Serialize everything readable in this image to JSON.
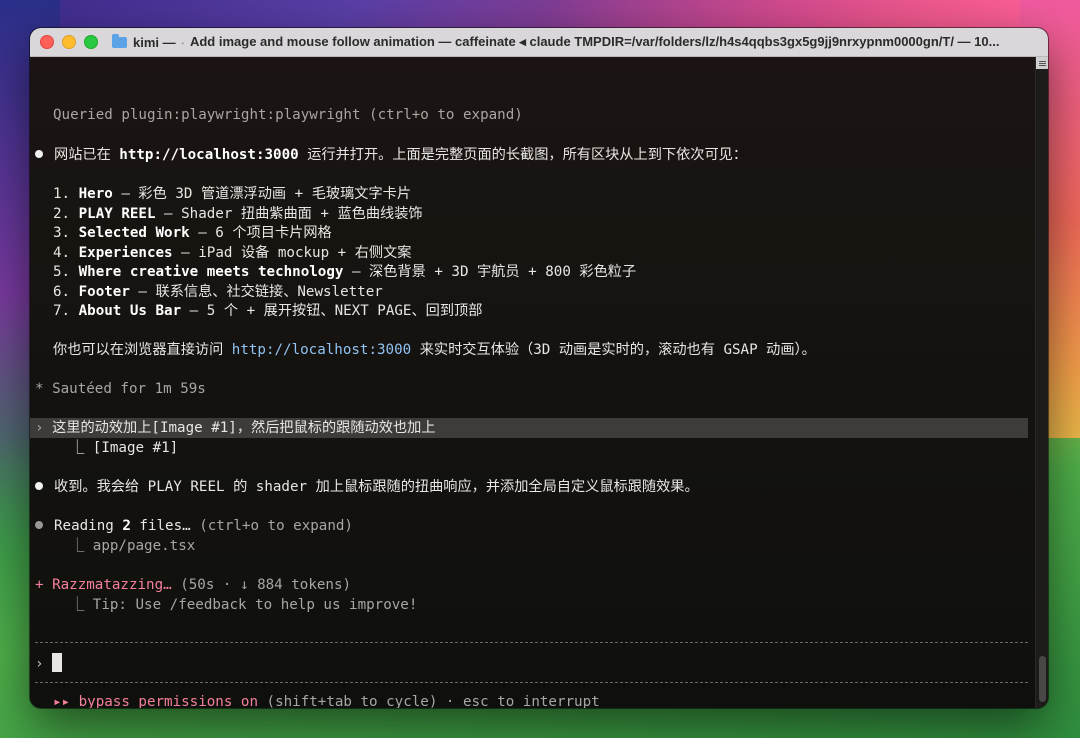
{
  "window": {
    "title_app": "kimi —",
    "title_dot": "·",
    "title_text": "Add image and mouse follow animation — caffeinate ◂ claude TMPDIR=/var/folders/lz/h4s4qqbs3gx5g9jj9nrxypnm0000gn/T/ — 10..."
  },
  "terminal": {
    "queried": "Queried plugin:playwright:playwright (ctrl+o to expand)",
    "intro_prefix": "网站已在 ",
    "intro_link": "http://localhost:3000",
    "intro_suffix": " 运行并打开。上面是完整页面的长截图，所有区块从上到下依次可见：",
    "items": [
      {
        "num": "1.",
        "name": "Hero",
        "desc": " – 彩色 3D 管道漂浮动画 + 毛玻璃文字卡片"
      },
      {
        "num": "2.",
        "name": "PLAY REEL",
        "desc": " – Shader 扭曲紫曲面 + 蓝色曲线装饰"
      },
      {
        "num": "3.",
        "name": "Selected Work",
        "desc": " – 6 个项目卡片网格"
      },
      {
        "num": "4.",
        "name": "Experiences",
        "desc": " – iPad 设备 mockup + 右侧文案"
      },
      {
        "num": "5.",
        "name": "Where creative meets technology",
        "desc": " – 深色背景 + 3D 宇航员 + 800 彩色粒子"
      },
      {
        "num": "6.",
        "name": "Footer",
        "desc": " – 联系信息、社交链接、Newsletter"
      },
      {
        "num": "7.",
        "name": "About Us Bar",
        "desc": " – 5 个 + 展开按钮、NEXT PAGE、回到顶部"
      }
    ],
    "visit_prefix": "你也可以在浏览器直接访问 ",
    "visit_link": "http://localhost:3000",
    "visit_suffix": " 来实时交互体验（3D 动画是实时的，滚动也有 GSAP 动画）。",
    "sauteed": "* Sautéed for 1m 59s",
    "user_msg_caret": "›",
    "user_msg": " 这里的动效加上[Image #1]，然后把鼠标的跟随动效也加上",
    "user_attach": "  ⎿ [Image #1]",
    "reply": "收到。我会给 PLAY REEL 的 shader 加上鼠标跟随的扭曲响应，并添加全局自定义鼠标跟随效果。",
    "reading_prefix": "Reading ",
    "reading_count": "2",
    "reading_mid": " files…",
    "reading_suffix": " (ctrl+o to expand)",
    "reading_file": "  ⎿ app/page.tsx",
    "status_star": "+",
    "status_word": " Razzmatazzing…",
    "status_meta": " (50s · ↓ 884 tokens)",
    "tip": "  ⎿ Tip: Use /feedback to help us improve!",
    "prompt_caret": "›",
    "mode_icon": "▸▸",
    "mode_label": " bypass permissions on",
    "mode_hint": " (shift+tab to cycle) · esc to interrupt"
  },
  "colors": {
    "link": "#8fc3f2",
    "status_pink": "#f5809a",
    "terminal_bg": "#161513"
  }
}
